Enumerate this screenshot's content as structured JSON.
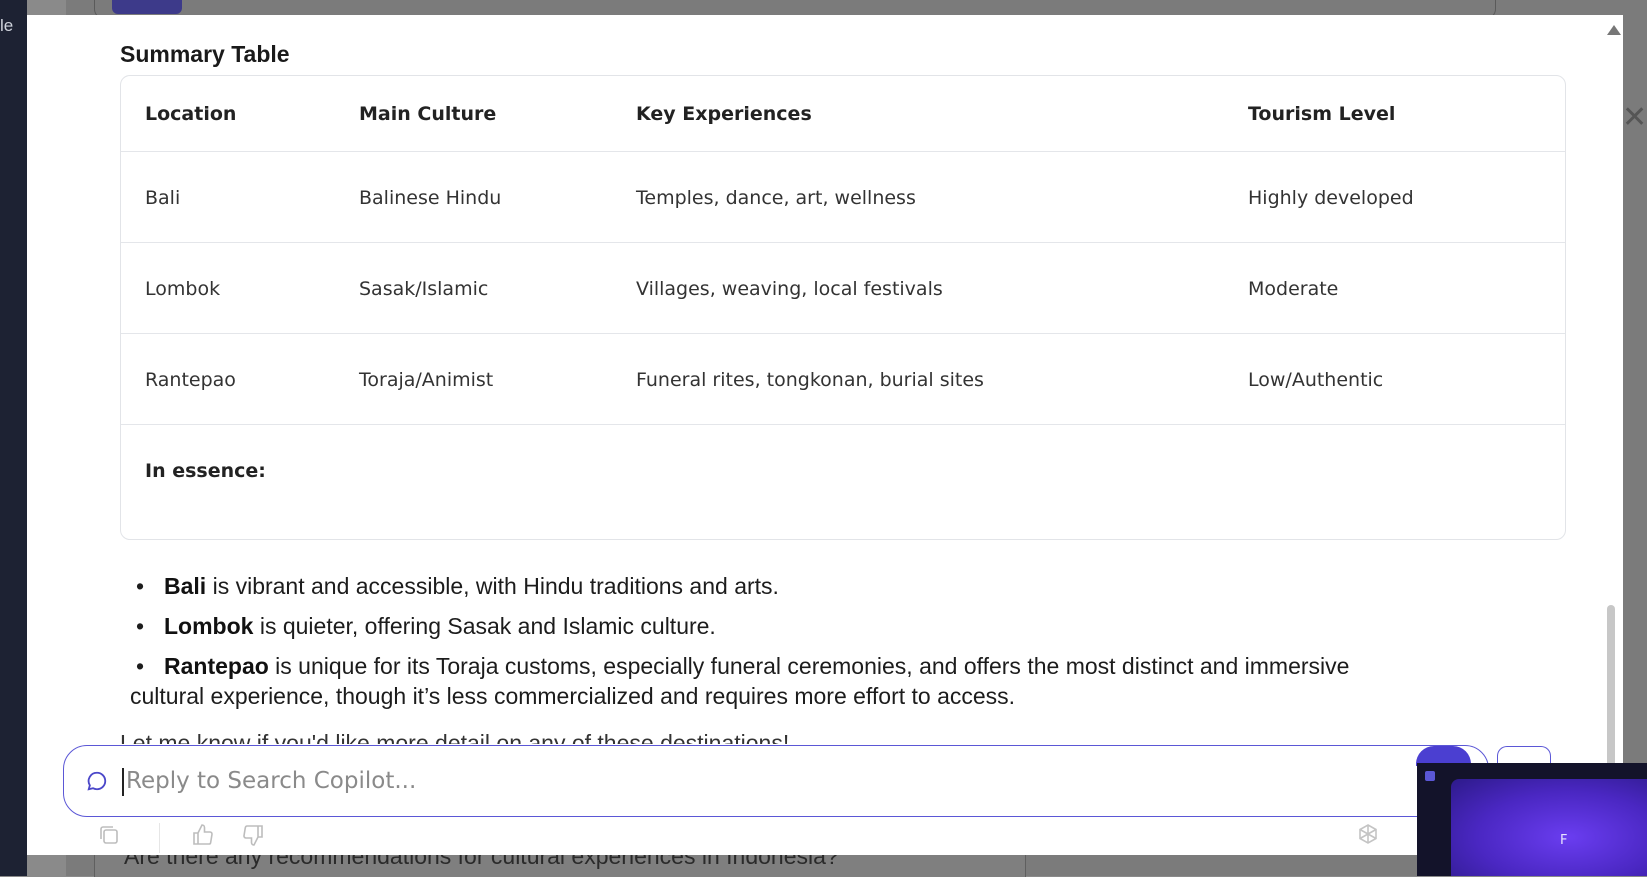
{
  "background": {
    "left_fragment": "le",
    "bottom_question": "Are there any recommendations for cultural experiences in Indonesia?"
  },
  "summary": {
    "title": "Summary Table",
    "columns": [
      "Location",
      "Main Culture",
      "Key Experiences",
      "Tourism Level"
    ],
    "rows": [
      [
        "Bali",
        "Balinese Hindu",
        "Temples, dance, art, wellness",
        "Highly developed"
      ],
      [
        "Lombok",
        "Sasak/Islamic",
        "Villages, weaving, local festivals",
        "Moderate"
      ],
      [
        "Rantepao",
        "Toraja/Animist",
        "Funeral rites, tongkonan, burial sites",
        "Low/Authentic"
      ]
    ],
    "essence_label": "In essence:"
  },
  "bullets": [
    {
      "bold": "Bali",
      "text": " is vibrant and accessible, with Hindu traditions and arts."
    },
    {
      "bold": "Lombok",
      "text": " is quieter, offering Sasak and Islamic culture."
    },
    {
      "bold": "Rantepao",
      "text": " is unique for its Toraja customs, especially funeral ceremonies, and offers the most distinct and immersive",
      "text2": "cultural experience, though it’s less commercialized and requires more effort to access."
    }
  ],
  "trailing_text": "Let me know if you'd like more detail on any of these destinations!",
  "reply": {
    "placeholder": "Reply to Search Copilot..."
  },
  "video_widget": {
    "letter": "F"
  },
  "colors": {
    "accent": "#5b57d6",
    "send": "#4b3fd1"
  },
  "icons": [
    "chat-bubble-icon",
    "copy-icon",
    "thumbs-up-icon",
    "thumbs-down-icon",
    "bot-icon",
    "scroll-up-icon"
  ]
}
